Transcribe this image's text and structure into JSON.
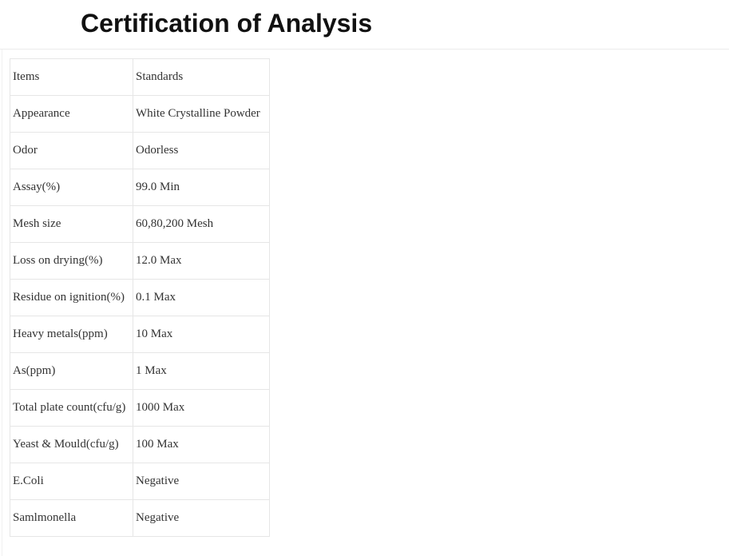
{
  "page": {
    "title": "Certification of Analysis"
  },
  "table": {
    "rows": [
      {
        "item": "Items",
        "standard": "Standards"
      },
      {
        "item": "Appearance",
        "standard": "White Crystalline Powder"
      },
      {
        "item": "Odor",
        "standard": "Odorless"
      },
      {
        "item": "Assay(%)",
        "standard": "99.0 Min"
      },
      {
        "item": "Mesh size",
        "standard": "60,80,200 Mesh"
      },
      {
        "item": "Loss on drying(%)",
        "standard": "12.0 Max"
      },
      {
        "item": "Residue on ignition(%)",
        "standard": "0.1 Max"
      },
      {
        "item": "Heavy metals(ppm)",
        "standard": "10 Max"
      },
      {
        "item": "As(ppm)",
        "standard": "1 Max"
      },
      {
        "item": "Total plate count(cfu/g)",
        "standard": "1000 Max"
      },
      {
        "item": "Yeast & Mould(cfu/g)",
        "standard": "100 Max"
      },
      {
        "item": "E.Coli",
        "standard": "Negative"
      },
      {
        "item": "Samlmonella",
        "standard": "Negative"
      }
    ]
  }
}
